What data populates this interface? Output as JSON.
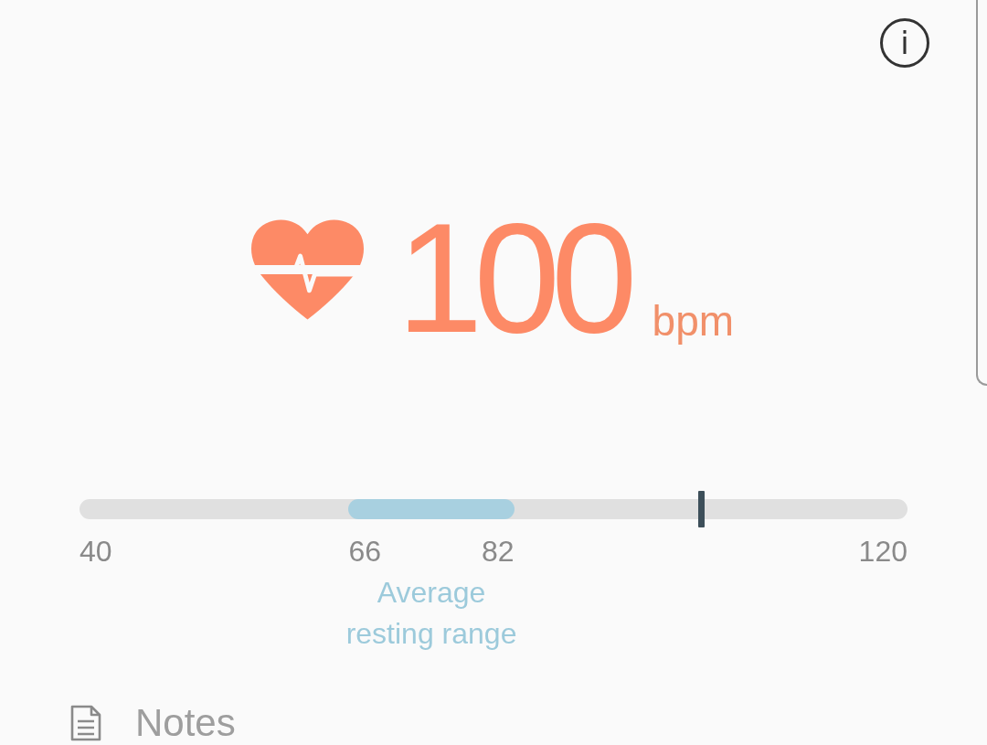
{
  "info_button": {
    "label": "i"
  },
  "reading": {
    "value": "100",
    "unit": "bpm"
  },
  "scale": {
    "min_label": "40",
    "max_label": "120",
    "range": {
      "start_label": "66",
      "end_label": "82",
      "caption": "Average resting range"
    },
    "marker": {
      "level": 0.75
    }
  },
  "notes": {
    "label": "Notes"
  }
}
